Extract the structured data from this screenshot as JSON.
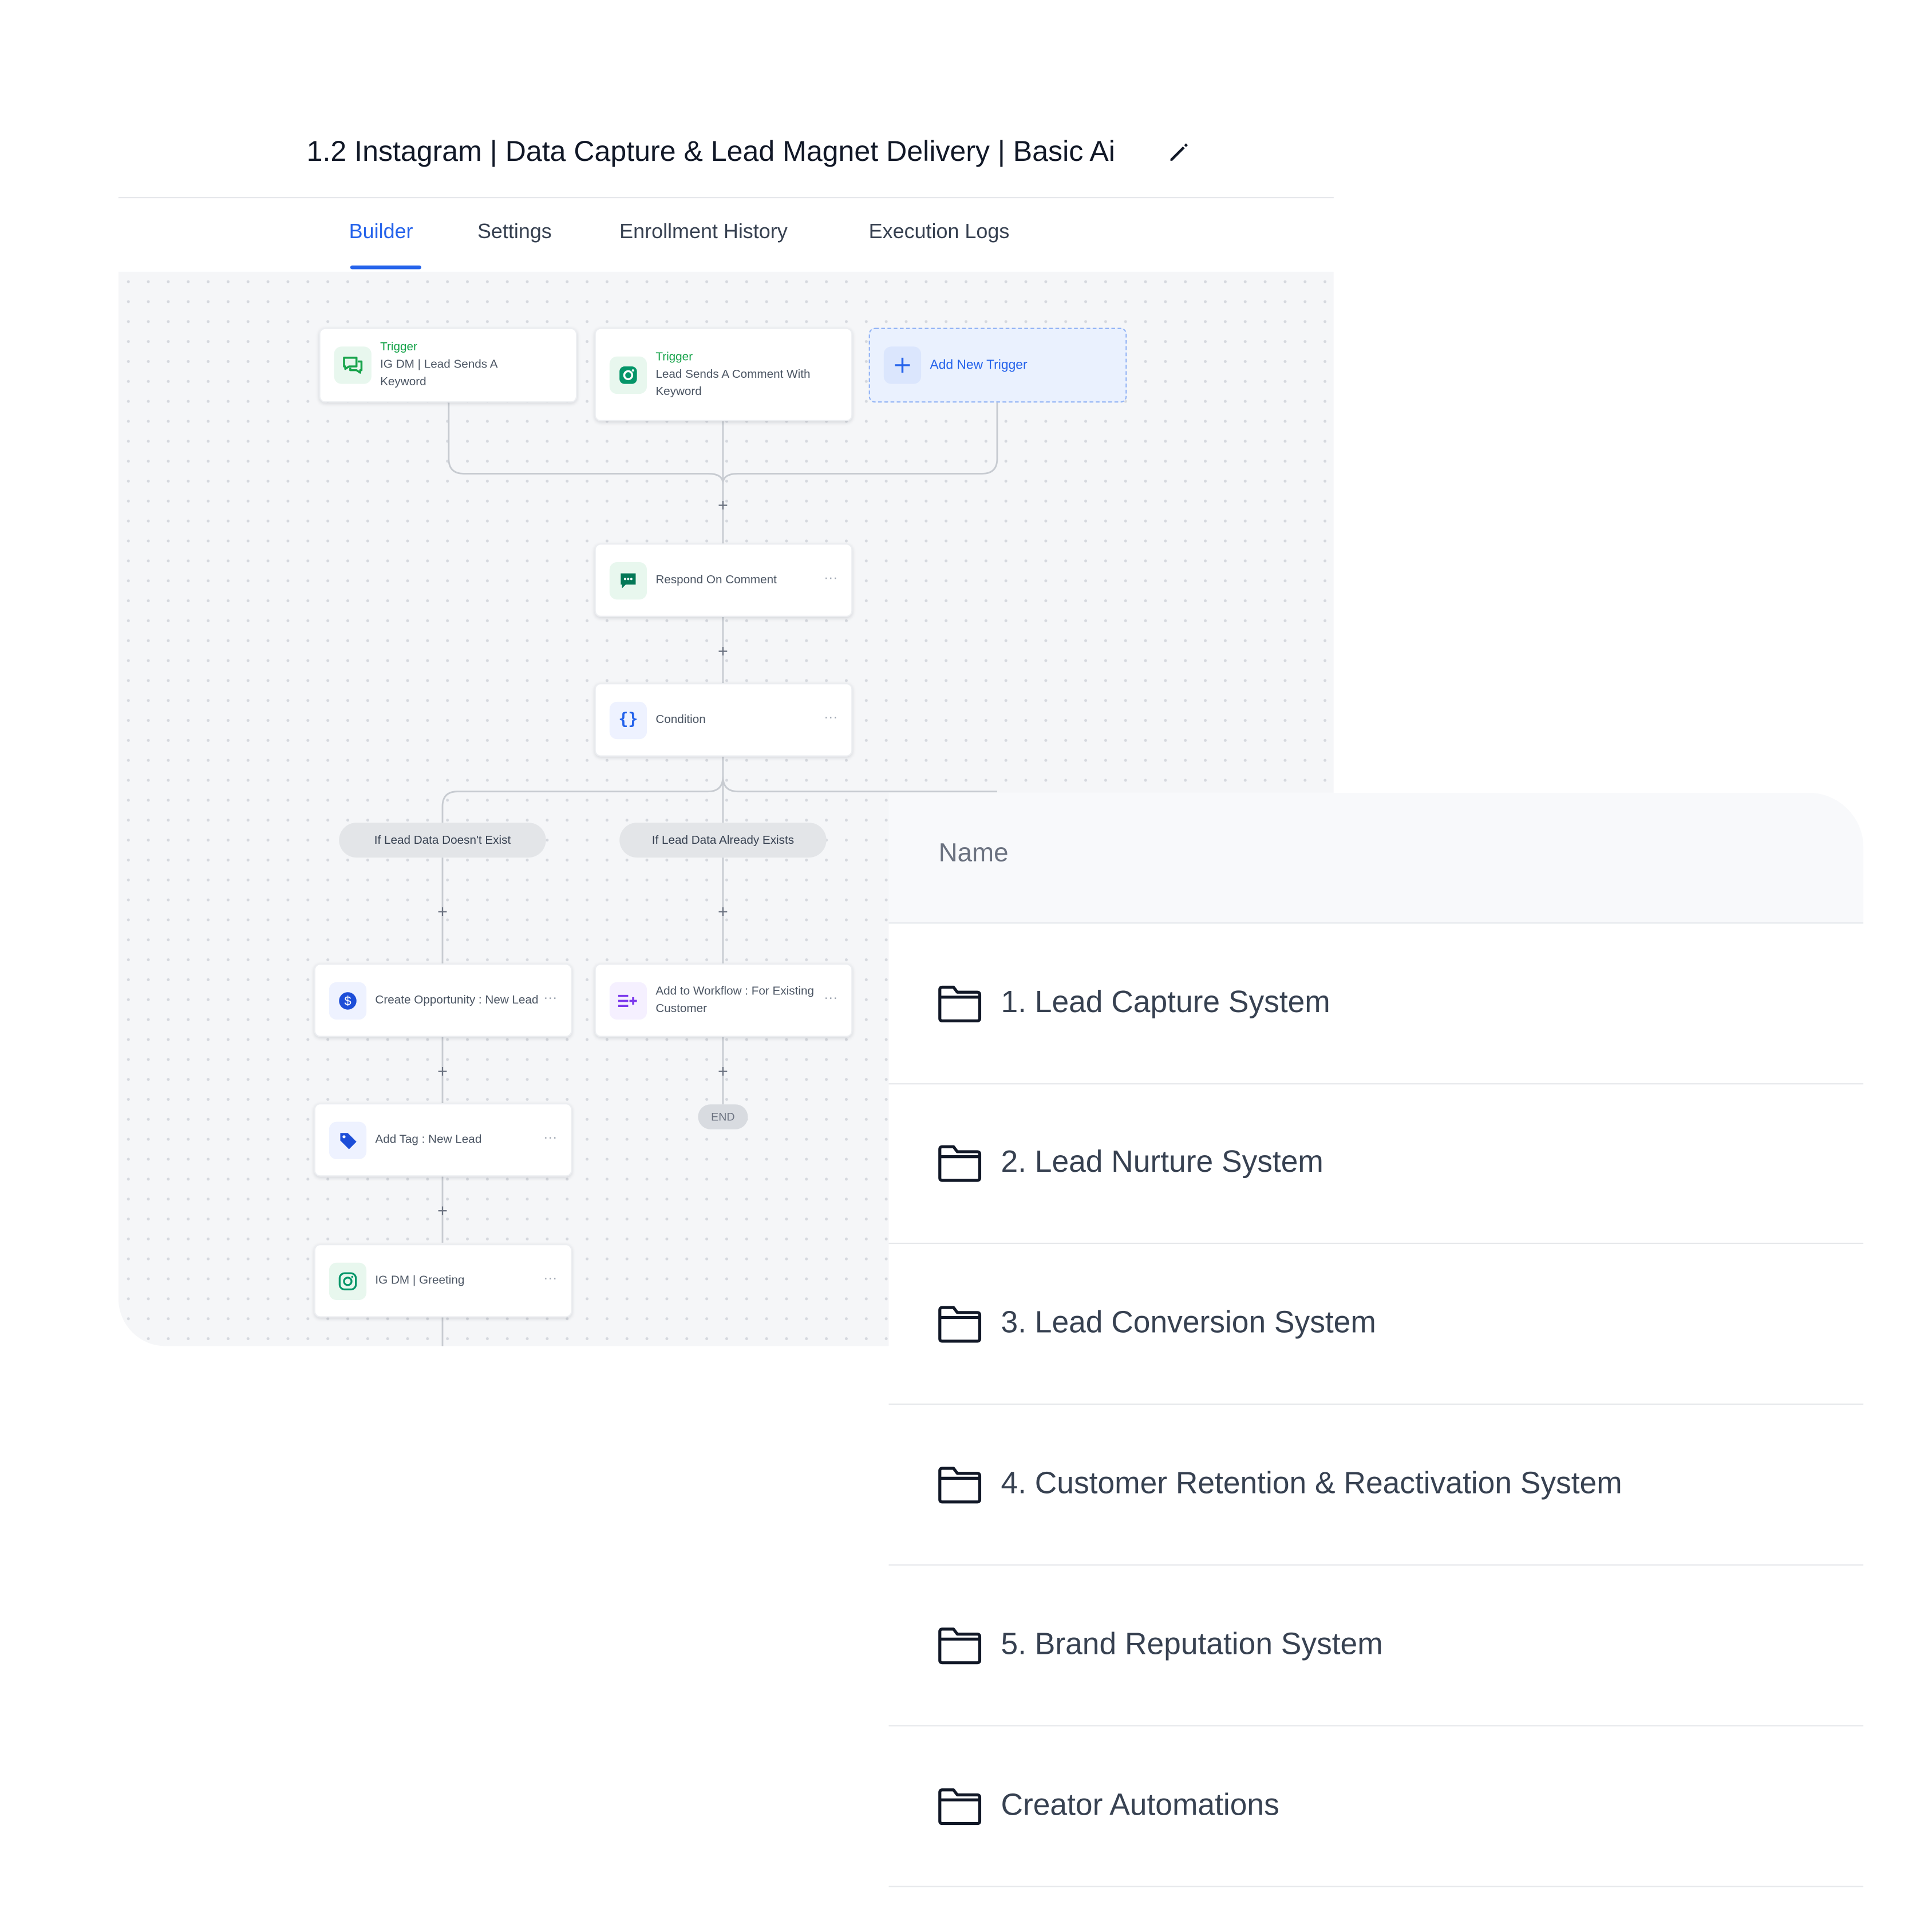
{
  "workflow": {
    "title": "1.2 Instagram | Data Capture & Lead Magnet Delivery | Basic Ai",
    "tabs": [
      "Builder",
      "Settings",
      "Enrollment History",
      "Execution Logs"
    ],
    "active_tab": "Builder",
    "triggers": [
      {
        "label": "Trigger",
        "text": "IG DM | Lead Sends A Keyword",
        "icon": "chat-bubbles-icon"
      },
      {
        "label": "Trigger",
        "text": "Lead Sends A Comment With Keyword",
        "icon": "instagram-icon"
      }
    ],
    "add_trigger_label": "Add New Trigger",
    "actions": {
      "respond_on_comment": "Respond On Comment",
      "condition": "Condition",
      "create_opportunity": "Create Opportunity : New Lead",
      "add_to_workflow": "Add to Workflow : For Existing Customer",
      "add_tag": "Add Tag : New Lead",
      "ig_dm_greeting": "IG DM | Greeting"
    },
    "branches": [
      "If Lead Data Doesn't Exist",
      "If Lead Data Already Exists"
    ],
    "end_label": "END",
    "more_symbol": "···",
    "plus_symbol": "+",
    "accent_color": "#2563eb"
  },
  "folders": {
    "column_header": "Name",
    "items": [
      "1. Lead Capture System",
      "2. Lead Nurture System",
      "3. Lead Conversion System",
      "4. Customer Retention & Reactivation System",
      "5. Brand Reputation System",
      "Creator Automations"
    ],
    "icon": "folder-icon"
  }
}
